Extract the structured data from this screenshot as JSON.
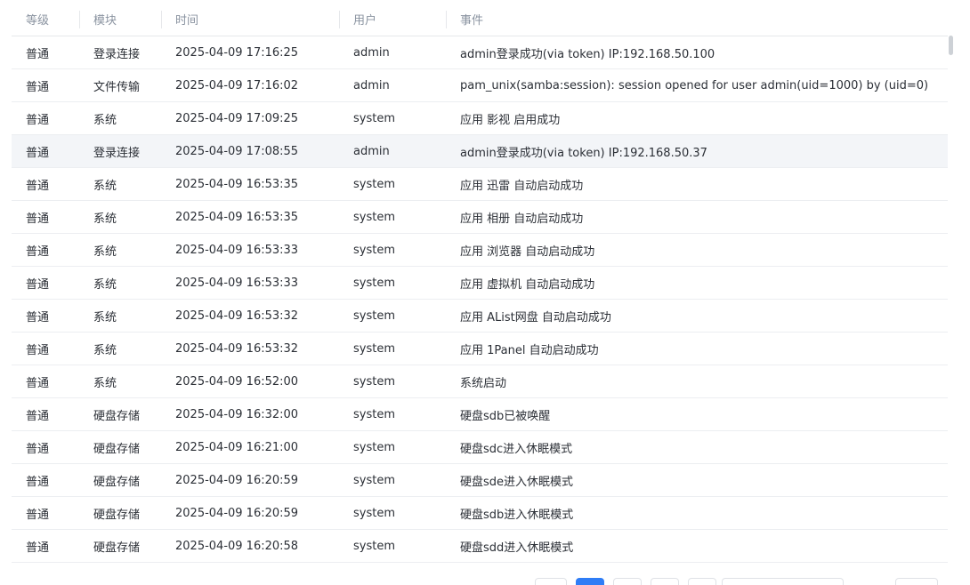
{
  "columns": {
    "level": "等级",
    "module": "模块",
    "time": "时间",
    "user": "用户",
    "event": "事件"
  },
  "rows": [
    {
      "level": "普通",
      "module": "登录连接",
      "time": "2025-04-09 17:16:25",
      "user": "admin",
      "event": "admin登录成功(via token) IP:192.168.50.100"
    },
    {
      "level": "普通",
      "module": "文件传输",
      "time": "2025-04-09 17:16:02",
      "user": "admin",
      "event": "pam_unix(samba:session): session opened for user admin(uid=1000) by (uid=0)"
    },
    {
      "level": "普通",
      "module": "系统",
      "time": "2025-04-09 17:09:25",
      "user": "system",
      "event": "应用 影视 启用成功"
    },
    {
      "level": "普通",
      "module": "登录连接",
      "time": "2025-04-09 17:08:55",
      "user": "admin",
      "event": "admin登录成功(via token) IP:192.168.50.37"
    },
    {
      "level": "普通",
      "module": "系统",
      "time": "2025-04-09 16:53:35",
      "user": "system",
      "event": "应用 迅雷 自动启动成功"
    },
    {
      "level": "普通",
      "module": "系统",
      "time": "2025-04-09 16:53:35",
      "user": "system",
      "event": "应用 相册 自动启动成功"
    },
    {
      "level": "普通",
      "module": "系统",
      "time": "2025-04-09 16:53:33",
      "user": "system",
      "event": "应用 浏览器 自动启动成功"
    },
    {
      "level": "普通",
      "module": "系统",
      "time": "2025-04-09 16:53:33",
      "user": "system",
      "event": "应用 虚拟机 自动启动成功"
    },
    {
      "level": "普通",
      "module": "系统",
      "time": "2025-04-09 16:53:32",
      "user": "system",
      "event": "应用 AList网盘 自动启动成功"
    },
    {
      "level": "普通",
      "module": "系统",
      "time": "2025-04-09 16:53:32",
      "user": "system",
      "event": "应用 1Panel 自动启动成功"
    },
    {
      "level": "普通",
      "module": "系统",
      "time": "2025-04-09 16:52:00",
      "user": "system",
      "event": "系统启动"
    },
    {
      "level": "普通",
      "module": "硬盘存储",
      "time": "2025-04-09 16:32:00",
      "user": "system",
      "event": "硬盘sdb已被唤醒"
    },
    {
      "level": "普通",
      "module": "硬盘存储",
      "time": "2025-04-09 16:21:00",
      "user": "system",
      "event": "硬盘sdc进入休眠模式"
    },
    {
      "level": "普通",
      "module": "硬盘存储",
      "time": "2025-04-09 16:20:59",
      "user": "system",
      "event": "硬盘sde进入休眠模式"
    },
    {
      "level": "普通",
      "module": "硬盘存储",
      "time": "2025-04-09 16:20:59",
      "user": "system",
      "event": "硬盘sdb进入休眠模式"
    },
    {
      "level": "普通",
      "module": "硬盘存储",
      "time": "2025-04-09 16:20:58",
      "user": "system",
      "event": "硬盘sdd进入休眠模式"
    }
  ],
  "hovered_row": 3,
  "pagination": {
    "active_page": 2,
    "colors": {
      "active": "#2f7df6"
    }
  }
}
